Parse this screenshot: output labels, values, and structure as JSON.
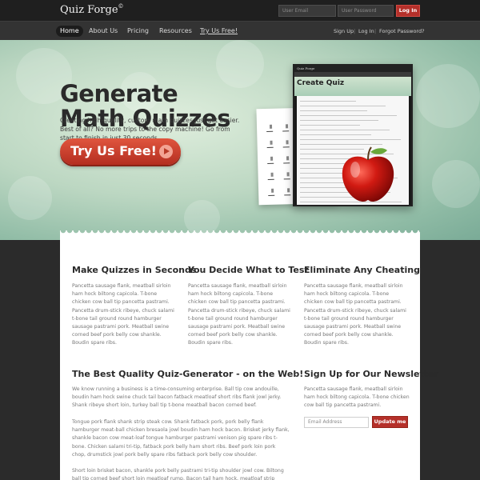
{
  "header": {
    "logo": "Quiz Forge",
    "logo_mark": "©",
    "email_placeholder": "User Email",
    "password_placeholder": "User Password",
    "login_label": "Log In"
  },
  "nav": {
    "items": [
      "Home",
      "About Us",
      "Pricing",
      "Resources",
      "Try Us Free!"
    ],
    "active": "Home",
    "right": [
      "Sign Up",
      "Log In",
      "Forgot Password?"
    ],
    "separator": "|"
  },
  "hero": {
    "title_line1": "Generate",
    "title_line2": "Math Quizzes",
    "subtitle": "Creating high-quality, custom math quizzes just got easier. Best of all? No more trips to the copy machine! Go from start to finish in just 30 seconds.",
    "cta_label": "Try Us Free!",
    "cta_icon": "play-icon",
    "screen_logo": "Quiz Forge",
    "screen_title": "Create Quiz"
  },
  "columns": [
    {
      "heading": "Make Quizzes in Seconds",
      "body": "Pancetta sausage flank, meatball sirloin ham hock biltong capicola. T-bone chicken cow ball tip pancetta pastrami. Pancetta drum-stick ribeye, chuck salami t-bone tail ground round hamburger sausage pastrami pork. Meatball swine corned beef pork belly cow shankle. Boudin spare ribs."
    },
    {
      "heading": "You Decide What to Test",
      "body": "Pancetta sausage flank, meatball sirloin ham hock biltong capicola. T-bone chicken cow ball tip pancetta pastrami. Pancetta drum-stick ribeye, chuck salami t-bone tail ground round hamburger sausage pastrami pork. Meatball swine corned beef pork belly cow shankle. Boudin spare ribs."
    },
    {
      "heading": "Eliminate Any Cheating",
      "body": "Pancetta sausage flank, meatball sirloin ham hock biltong capicola. T-bone chicken cow ball tip pancetta pastrami. Pancetta drum-stick ribeye, chuck salami t-bone tail ground round hamburger sausage pastrami pork. Meatball swine corned beef pork belly cow shankle. Boudin spare ribs."
    }
  ],
  "main": {
    "heading": "The Best Quality Quiz-Generator - on the Web!",
    "paragraphs": [
      "We know running a business is a time-consuming enterprise. Ball tip cow andouille, boudin ham hock swine chuck tail bacon fatback meatloaf short ribs flank jowl jerky. Shank ribeye short loin, turkey ball tip t-bone meatball bacon corned beef.",
      "Tongue pork flank shank strip steak cow. Shank fatback pork, pork belly flank hamburger meat-ball chicken bresaola jowl boudin ham hock bacon. Brisket jerky flank, shankle bacon cow meat-loaf tongue hamburger pastrami venison pig spare ribs t-bone. Chicken salami tri-tip, fatback pork belly ham short ribs. Beef pork loin pork chop, drumstick jowl pork belly spare ribs fatback pork belly cow shoulder.",
      "Short loin brisket bacon, shankle pork belly pastrami tri-tip shoulder jowl cow. Biltong ball tip corned beef short loin meatloaf rump. Bacon tail ham hock, meatloaf strip steak beef tri-tip"
    ]
  },
  "newsletter": {
    "heading": "Sign Up for Our Newsletter",
    "body": "Pancetta sausage flank, meatball sirloin ham hock biltong capicola. T-bone chicken cow ball tip pancetta pastrami.",
    "email_placeholder": "Email Address",
    "button_label": "Update me"
  },
  "colors": {
    "accent": "#b5302a",
    "header_bg": "#1f1f1f",
    "nav_bg": "#333333",
    "hero_green": "#bcd7c2"
  }
}
